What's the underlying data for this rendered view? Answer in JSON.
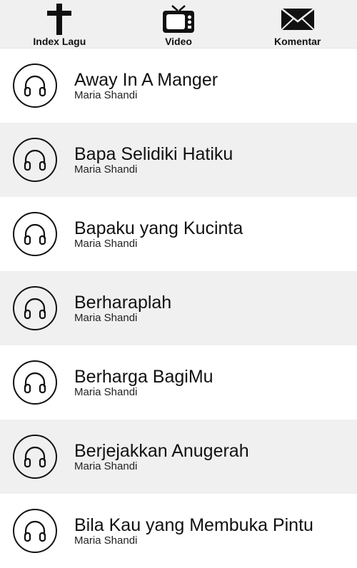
{
  "nav": {
    "items": [
      {
        "label": "Index Lagu",
        "icon": "cross-icon"
      },
      {
        "label": "Video",
        "icon": "tv-icon"
      },
      {
        "label": "Komentar",
        "icon": "envelope-icon"
      }
    ]
  },
  "songs": [
    {
      "title": "Away In A Manger",
      "artist": "Maria Shandi",
      "icon": "headphones-icon"
    },
    {
      "title": "Bapa Selidiki Hatiku",
      "artist": "Maria Shandi",
      "icon": "headphones-icon"
    },
    {
      "title": "Bapaku yang Kucinta",
      "artist": "Maria Shandi",
      "icon": "headphones-icon"
    },
    {
      "title": "Berharaplah",
      "artist": "Maria Shandi",
      "icon": "headphones-icon"
    },
    {
      "title": "Berharga BagiMu",
      "artist": "Maria Shandi",
      "icon": "headphones-icon"
    },
    {
      "title": "Berjejakkan Anugerah",
      "artist": "Maria Shandi",
      "icon": "headphones-icon"
    },
    {
      "title": "Bila Kau yang Membuka Pintu",
      "artist": "Maria Shandi",
      "icon": "headphones-icon"
    }
  ],
  "colors": {
    "row_alt": "#f0f0f0",
    "row": "#ffffff",
    "icon": "#111111"
  }
}
